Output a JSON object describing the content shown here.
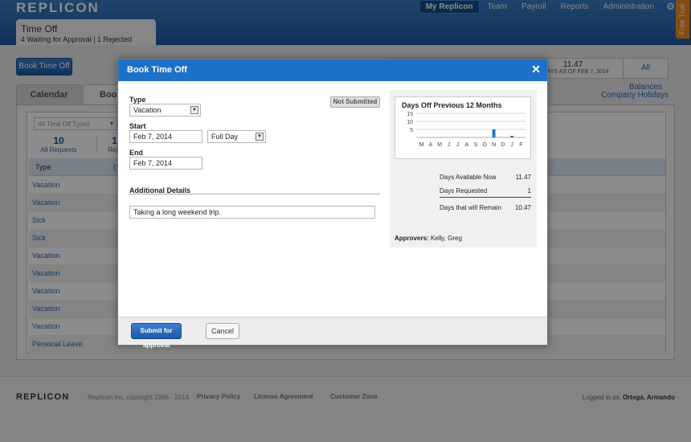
{
  "header": {
    "logo": "REPLICON",
    "nav": [
      "My Replicon",
      "Team",
      "Payroll",
      "Reports",
      "Administration"
    ],
    "free_trial": "Free Trial"
  },
  "page_tab": {
    "title": "Time Off",
    "subtitle": "4 Waiting for Approval | 1 Rejected"
  },
  "book_button": "Book Time Off",
  "balances": {
    "value": "11.47",
    "label": "E DAYS AS OF FEB 7, 2014",
    "all_link": "All Balances"
  },
  "tabs": {
    "calendar": "Calendar",
    "book": "Book"
  },
  "company_holidays": "Company Holidays",
  "filter": {
    "placeholder": "All Time Off Types"
  },
  "stats": [
    {
      "count": "10",
      "label": "All Requests"
    },
    {
      "count": "1",
      "label": "Reje"
    }
  ],
  "table": {
    "header": "Type",
    "header_count": "(1",
    "rows": [
      "Vacation",
      "Vacation",
      "Sick",
      "Sick",
      "Vacation",
      "Vacation",
      "Vacation",
      "Vacation",
      "Vacation",
      "Personal Leave"
    ]
  },
  "footer": {
    "logo": "REPLICON",
    "copyright": "Replicon Inc, copyright 1996 - 2014",
    "links": [
      "Privacy Policy",
      "License Agreement",
      "Customer Zone"
    ],
    "logged_in_label": "Logged in as:",
    "user": "Ortega, Armando"
  },
  "dialog": {
    "title": "Book Time Off",
    "type_label": "Type",
    "type_value": "Vacation",
    "status": "Not Submitted",
    "start_label": "Start",
    "start_date": "Feb 7, 2014",
    "duration": "Full Day",
    "end_label": "End",
    "end_date": "Feb 7, 2014",
    "details_label": "Additional Details",
    "details_value": "Taking a long weekend trip.",
    "submit": "Submit for approval",
    "cancel": "Cancel",
    "summary": {
      "available_label": "Days Available Now",
      "available_value": "11.47",
      "requested_label": "Days Requested",
      "requested_value": "1",
      "remain_label": "Days that will Remain",
      "remain_value": "10.47",
      "approvers_label": "Approvers:",
      "approvers_value": "Kelly, Greg"
    }
  },
  "chart_data": {
    "type": "bar",
    "title": "Days Off Previous 12 Months",
    "categories": [
      "M",
      "A",
      "M",
      "J",
      "J",
      "A",
      "S",
      "O",
      "N",
      "D",
      "J",
      "F"
    ],
    "values": [
      0,
      0,
      0,
      0,
      0,
      0,
      0,
      0,
      5,
      0,
      1,
      0
    ],
    "yticks": [
      15,
      10,
      5
    ],
    "ylim": [
      0,
      15
    ],
    "color": "#1c7ec6",
    "grid": true
  }
}
